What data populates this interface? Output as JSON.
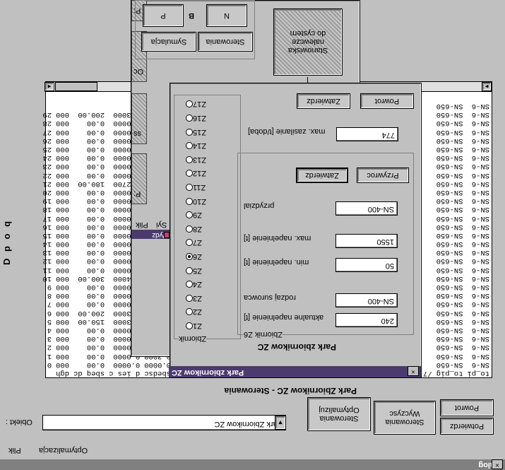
{
  "main": {
    "title": "Dialog",
    "close": "×",
    "menu": [
      "Plik",
      "Optymalizacja"
    ],
    "objects_label": "Obiekt :",
    "objects_value": "Park Zbiornikow ZC",
    "dropdown_arrow": "▼",
    "panel_title": "Park Zbiornikow ZC - Sterowania",
    "buttons": {
      "optimize": "Sterowania Optymalizuj",
      "clear": "Sterowania Wyczysc",
      "back": "Powrot",
      "confirm": "Potwierdz"
    },
    "side_label": "D p o q"
  },
  "table": {
    "headers": [
      "dgh",
      "sbeq dc",
      "d ies c",
      "sbedsc"
    ],
    "rows": [
      [
        "0",
        "000",
        "0.00",
        "0.0000",
        "0.0000"
      ],
      [
        "1",
        "000",
        "0.00",
        "0.0000",
        "0.3000"
      ],
      [
        "2",
        "000",
        "0.00",
        "0.0000",
        ""
      ],
      [
        "3",
        "000",
        "0.00",
        "0.0000",
        ""
      ],
      [
        "4",
        "000",
        "0.00",
        "0.0000",
        ""
      ],
      [
        "5",
        "000",
        "150.00",
        "0.3000",
        ""
      ],
      [
        "6",
        "000",
        "200.00",
        "0.3000",
        ""
      ],
      [
        "7",
        "000",
        "0.00",
        "0.0000",
        ""
      ],
      [
        "8",
        "000",
        "0.00",
        "0.0000",
        ""
      ],
      [
        "9",
        "000",
        "0.00",
        "0.0000",
        ""
      ],
      [
        "10",
        "000",
        "300.00",
        "0.4000",
        ""
      ],
      [
        "11",
        "000",
        "0.00",
        "0.0000",
        ""
      ],
      [
        "12",
        "000",
        "0.00",
        "0.0000",
        ""
      ],
      [
        "13",
        "000",
        "0.00",
        "0.0000",
        ""
      ],
      [
        "14",
        "000",
        "0.00",
        "0.0000",
        ""
      ],
      [
        "15",
        "000",
        "0.00",
        "0.0000",
        ""
      ],
      [
        "16",
        "000",
        "0.00",
        "0.0000",
        ""
      ],
      [
        "17",
        "000",
        "0.00",
        "0.0000",
        ""
      ],
      [
        "18",
        "000",
        "0.00",
        "0.0000",
        ""
      ],
      [
        "19",
        "000",
        "0.00",
        "0.0000",
        ""
      ],
      [
        "20",
        "000",
        "0.00",
        "0.0000",
        ""
      ],
      [
        "21",
        "000",
        "180.00",
        "0.2700",
        ""
      ],
      [
        "22",
        "000",
        "0.00",
        "0.0000",
        ""
      ],
      [
        "23",
        "000",
        "0.00",
        "0.0000",
        ""
      ],
      [
        "24",
        "000",
        "0.00",
        "0.0000",
        ""
      ],
      [
        "25",
        "000",
        "0.00",
        "0.0000",
        ""
      ],
      [
        "26",
        "000",
        "0.00",
        "0.0000",
        ""
      ],
      [
        "27",
        "000",
        "0.00",
        "0.0000",
        ""
      ],
      [
        "28",
        "000",
        "0.00",
        "0.0000",
        ""
      ],
      [
        "29",
        "000",
        "200.00",
        "0.3000",
        ""
      ]
    ],
    "right_headers": [
      "to_pig",
      "to_pi"
    ],
    "right_cells": [
      "SN-650",
      "SN-6"
    ],
    "right_rows": 31,
    "left_scroll": "◄",
    "right_scroll": "►"
  },
  "bg_window": {
    "menu": [
      "Plik",
      "Syi"
    ],
    "option": "Wydz",
    "buttons": {
      "station": "Stanowiska nalewcze do cystern",
      "simulation": "Symulacja",
      "control": "Sterowania",
      "p": "P",
      "b": "B",
      "n": "N"
    },
    "side_boxes": [
      "P:",
      "ss",
      "Oc",
      "P:",
      "Z"
    ]
  },
  "park_dialog": {
    "title": "Park zbiornikow ZC",
    "close": "×",
    "heading": "Park zbiornikow ZC",
    "tanks_group": "Zbiornik",
    "tanks": [
      "Z1",
      "Z2",
      "Z3",
      "Z4",
      "Z5",
      "Z6",
      "Z7",
      "Z8",
      "Z9",
      "Z10",
      "Z11",
      "Z12",
      "Z13",
      "Z14",
      "Z15",
      "Z16",
      "Z17"
    ],
    "selected_tank": "Z6",
    "details_group": "Zbiornik Z6",
    "fields": {
      "current_fill_label": "aktualne napelnienie [t]",
      "current_fill": "240",
      "material_label": "rodzaj surowca",
      "material": "SN-400",
      "min_fill_label": "min. napelnienie [t]",
      "min_fill": "50",
      "max_fill_label": "max. napelnienie [t]",
      "max_fill": "1550",
      "assign_label": "przydzial",
      "assign": "SN-400",
      "max_supply_label": "max. zasilanie [t/doba]",
      "max_supply": "774"
    },
    "buttons": {
      "confirm_inner": "Zatwierdz",
      "restore": "Przywroc",
      "confirm": "Zatwierdz",
      "back": "Powrot"
    }
  }
}
